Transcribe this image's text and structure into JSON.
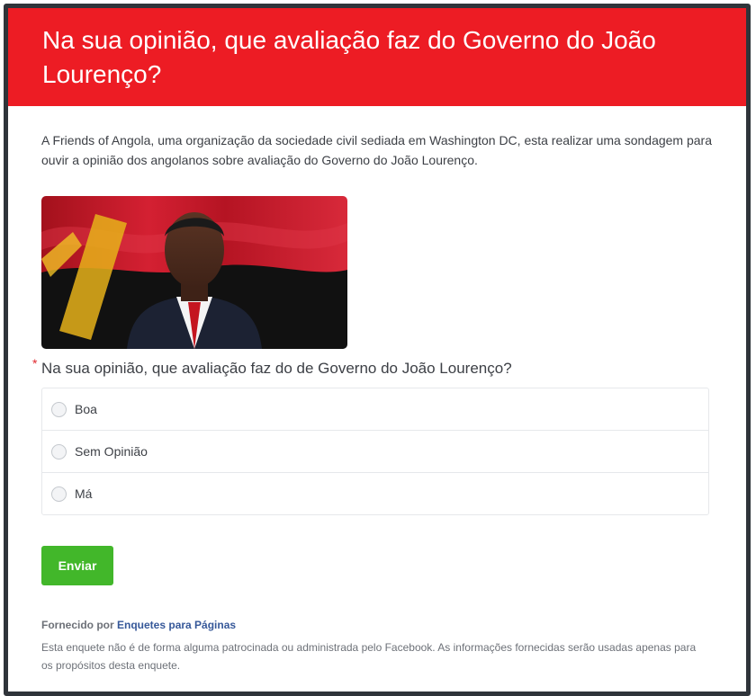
{
  "poll": {
    "title": "Na sua opinião, que avaliação faz do Governo do João Lourenço?",
    "description": "A Friends of Angola, uma organização da sociedade civil sediada em Washington DC, esta realizar uma sondagem para ouvir a opinião dos angolanos sobre avaliação do Governo do João Lourenço.",
    "question": "Na sua opinião, que avaliação faz do de Governo do João Lourenço?",
    "required_mark": "*",
    "options": [
      {
        "label": "Boa"
      },
      {
        "label": "Sem Opinião"
      },
      {
        "label": "Má"
      }
    ],
    "submit_label": "Enviar"
  },
  "footer": {
    "provided_by_prefix": "Fornecido por",
    "provided_by_link": "Enquetes para Páginas",
    "disclaimer": "Esta enquete não é de forma alguma patrocinada ou administrada pelo Facebook. As informações fornecidas serão usadas apenas para os propósitos desta enquete."
  },
  "colors": {
    "header": "#ed1c24",
    "frame": "#2f343a",
    "submit": "#42b72a",
    "link": "#365899"
  }
}
